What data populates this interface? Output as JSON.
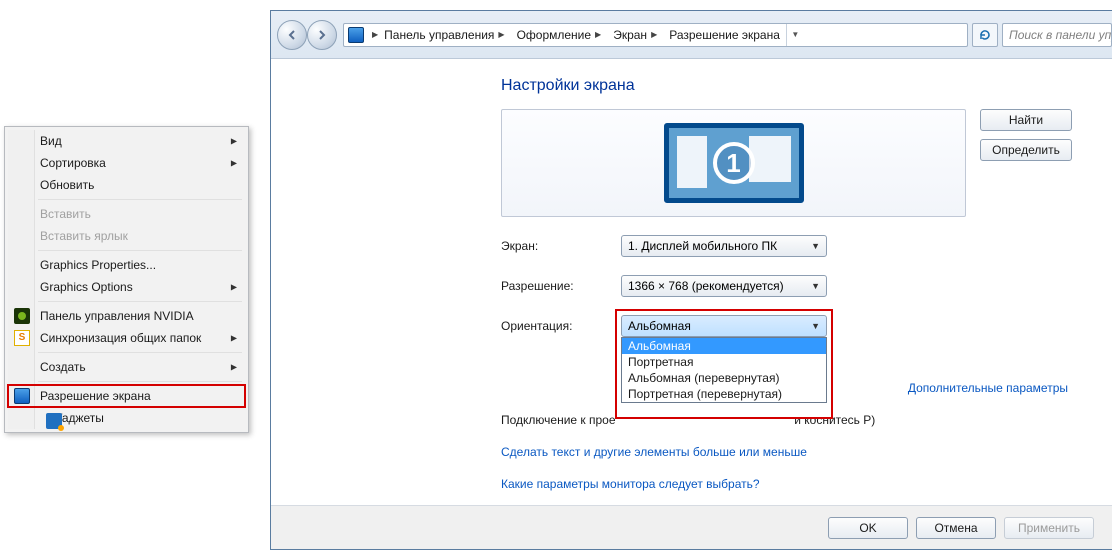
{
  "context_menu": {
    "items": [
      {
        "label": "Вид",
        "arrow": true
      },
      {
        "label": "Сортировка",
        "arrow": true
      },
      {
        "label": "Обновить"
      },
      {
        "sep": true
      },
      {
        "label": "Вставить",
        "disabled": true
      },
      {
        "label": "Вставить ярлык",
        "disabled": true
      },
      {
        "sep": true
      },
      {
        "label": "Graphics Properties..."
      },
      {
        "label": "Graphics Options",
        "arrow": true
      },
      {
        "sep": true
      },
      {
        "label": "Панель управления NVIDIA",
        "icon": "nvidia"
      },
      {
        "label": "Синхронизация общих папок",
        "icon": "sync",
        "arrow": true
      },
      {
        "sep": true
      },
      {
        "label": "Создать",
        "arrow": true
      },
      {
        "sep": true
      },
      {
        "label": "Разрешение экрана",
        "icon": "display",
        "highlighted": true
      },
      {
        "label": "Гаджеты",
        "icon": "gadget"
      }
    ]
  },
  "breadcrumb": {
    "items": [
      "Панель управления",
      "Оформление",
      "Экран",
      "Разрешение экрана"
    ]
  },
  "search": {
    "placeholder": "Поиск в панели упр"
  },
  "page": {
    "title": "Настройки экрана",
    "find_btn": "Найти",
    "identify_btn": "Определить",
    "monitor_number": "1",
    "labels": {
      "screen": "Экран:",
      "resolution": "Разрешение:",
      "orientation": "Ориентация:"
    },
    "screen_value": "1. Дисплей мобильного ПК",
    "resolution_value": "1366 × 768 (рекомендуется)",
    "orientation_value": "Альбомная",
    "orientation_options": [
      "Альбомная",
      "Портретная",
      "Альбомная (перевернутая)",
      "Портретная (перевернутая)"
    ],
    "adv_link": "Дополнительные параметры",
    "proj_prefix": "Подключение к прое",
    "proj_suffix": "и коснитесь P)",
    "text_link": "Сделать текст и другие элементы больше или меньше",
    "which_link": "Какие параметры монитора следует выбрать?"
  },
  "footer": {
    "ok": "OK",
    "cancel": "Отмена",
    "apply": "Применить"
  }
}
